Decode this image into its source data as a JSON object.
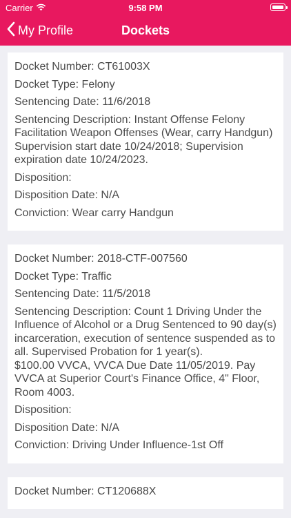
{
  "status_bar": {
    "carrier": "Carrier",
    "time": "9:58 PM"
  },
  "nav": {
    "back_label": "My Profile",
    "title": "Dockets"
  },
  "labels": {
    "docket_number": "Docket Number:",
    "docket_type": "Docket Type:",
    "sentencing_date": "Sentencing Date:",
    "sentencing_description": "Sentencing Description:",
    "disposition": "Disposition:",
    "disposition_date": "Disposition Date:",
    "conviction": "Conviction:"
  },
  "dockets": [
    {
      "docket_number": "CT61003X",
      "docket_type": "Felony",
      "sentencing_date": "11/6/2018",
      "sentencing_description": "Instant Offense Felony Facilitation Weapon Offenses (Wear, carry Handgun) Supervision start date 10/24/2018; Supervision expiration date 10/24/2023.",
      "disposition": "",
      "disposition_date": "N/A",
      "conviction": "Wear carry Handgun"
    },
    {
      "docket_number": "2018-CTF-007560",
      "docket_type": "Traffic",
      "sentencing_date": "11/5/2018",
      "sentencing_description": "Count 1 Driving Under the Influence of Alcohol or a Drug Sentenced to 90 day(s) incarceration, execution of sentence suspended as to all. Supervised Probation for 1 year(s).\n$100.00 VVCA, VVCA Due Date 11/05/2019. Pay VVCA at Superior Court's Finance Office, 4\" Floor, Room 4003.\n",
      "disposition": "",
      "disposition_date": "N/A",
      "conviction": "Driving Under Influence-1st Off"
    },
    {
      "docket_number": "CT120688X"
    }
  ]
}
